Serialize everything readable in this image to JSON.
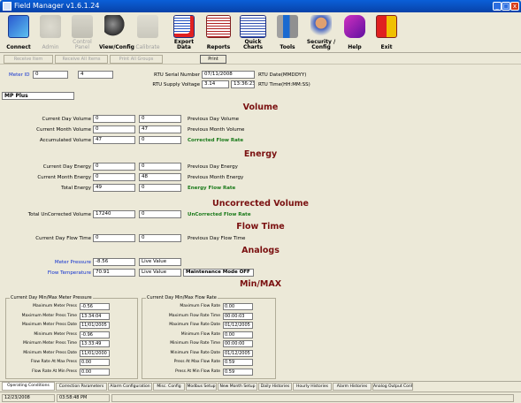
{
  "window": {
    "title": "Field Manager v1.6.1.24",
    "btn_min": "_",
    "btn_max": "□",
    "btn_close": "x"
  },
  "toolbar": [
    {
      "label": "Connect",
      "icon": "connect-icon",
      "enabled": true
    },
    {
      "label": "Admin",
      "icon": "admin-icon",
      "enabled": false
    },
    {
      "label": "Control Panel",
      "icon": "control-panel-icon",
      "enabled": false
    },
    {
      "label": "View/Config",
      "icon": "view-config-icon",
      "enabled": true
    },
    {
      "label": "Calibrate",
      "icon": "calibrate-icon",
      "enabled": false
    },
    {
      "label": "Export Data",
      "icon": "export-data-icon",
      "enabled": true
    },
    {
      "label": "Reports",
      "icon": "reports-icon",
      "enabled": true
    },
    {
      "label": "Quick Charts",
      "icon": "quick-charts-icon",
      "enabled": true
    },
    {
      "label": "Tools",
      "icon": "tools-icon",
      "enabled": true
    },
    {
      "label": "Security / Config",
      "icon": "security-config-icon",
      "enabled": true
    },
    {
      "label": "Help",
      "icon": "help-icon",
      "enabled": true
    },
    {
      "label": "Exit",
      "icon": "exit-icon",
      "enabled": true
    }
  ],
  "subbar": {
    "receive_item": "Receive Item",
    "receive_all": "Receive All Items",
    "print_all": "Print All Groups",
    "print": "Print"
  },
  "header": {
    "meter_id_label": "Meter ID",
    "meter_id": "0",
    "meter_id2": "4",
    "rtu_serial_label": "RTU Serial Number",
    "rtu_serial": "07/11/2008",
    "rtu_date_label": "RTU Date(MMDDYY)",
    "rtu_supply_label": "RTU Supply Voltage",
    "rtu_supply": "3.14",
    "rtu_time": "13:36:23",
    "rtu_time_label": "RTU Time(HH:MM:SS)",
    "meter_type": "MP Plus"
  },
  "volume": {
    "title": "Volume",
    "rows": [
      {
        "label": "Current Day Volume",
        "v1": "0",
        "v2": "0",
        "right": "Previous Day Volume",
        "right_style": "normal"
      },
      {
        "label": "Current Month Volume",
        "v1": "0",
        "v2": "47",
        "right": "Previous Month Volume",
        "right_style": "normal"
      },
      {
        "label": "Accumulated Volume",
        "v1": "47",
        "v2": "0",
        "right": "Corrected Flow Rate",
        "right_style": "green"
      }
    ]
  },
  "energy": {
    "title": "Energy",
    "rows": [
      {
        "label": "Current Day Energy",
        "v1": "0",
        "v2": "0",
        "right": "Previous Day Energy",
        "right_style": "normal"
      },
      {
        "label": "Current Month Energy",
        "v1": "0",
        "v2": "48",
        "right": "Previous Month Energy",
        "right_style": "normal"
      },
      {
        "label": "Total Energy",
        "v1": "49",
        "v2": "0",
        "right": "Energy Flow Rate",
        "right_style": "green"
      }
    ]
  },
  "uncorrected": {
    "title": "Uncorrected Volume",
    "label": "Total UnCorrected Volume",
    "v1": "17240",
    "v2": "0",
    "right": "UnCorrected Flow Rate"
  },
  "flowtime": {
    "title": "Flow Time",
    "label": "Current Day Flow Time",
    "v1": "0",
    "v2": "0",
    "right": "Previous Day Flow Time"
  },
  "analogs": {
    "title": "Analogs",
    "pressure_label": "Meter Pressure",
    "pressure": "-8.56",
    "pressure_mode": "Live Value",
    "temp_label": "Flow Temperature",
    "temp": "70.91",
    "temp_mode": "Live Value",
    "maintenance": "Maintenance Mode OFF"
  },
  "minmax": {
    "title": "Min/MAX",
    "left": {
      "title": "Current Day Min/Max Meter Pressure",
      "rows": [
        {
          "label": "Maximum Meter Press",
          "value": "-0.56"
        },
        {
          "label": "Maximum Meter Press Time",
          "value": "13:34:04"
        },
        {
          "label": "Maximum Meter Press Date",
          "value": "11/01/2005"
        },
        {
          "label": "Minimum Meter Press",
          "value": "-0.96"
        },
        {
          "label": "Minimum Meter Press Time",
          "value": "13:33:49"
        },
        {
          "label": "Minimum Meter Press Date",
          "value": "11/01/2000"
        },
        {
          "label": "Flow Rate At Max Press",
          "value": "0.00"
        },
        {
          "label": "Flow Rate At Min Press",
          "value": "0.00"
        }
      ]
    },
    "right": {
      "title": "Current Day Min/Max Flow Rate",
      "rows": [
        {
          "label": "Maximum Flow Rate",
          "value": "0.00"
        },
        {
          "label": "Maximum Flow Rate Time",
          "value": "00:00:03"
        },
        {
          "label": "Maximum Flow Rate Date",
          "value": "01/12/2005"
        },
        {
          "label": "Minimum Flow Rate",
          "value": "0.00"
        },
        {
          "label": "Minimum Flow Rate Time",
          "value": "00:00:00"
        },
        {
          "label": "Minimum Flow Rate Date",
          "value": "01/12/2005"
        },
        {
          "label": "Press At Max Flow Rate",
          "value": "0.59"
        },
        {
          "label": "Press At Min Flow Rate",
          "value": "0.59"
        }
      ]
    }
  },
  "tabs": [
    "Operating Conditions",
    "Correction Parameters",
    "Alarm Configuration",
    "Misc. Config",
    "Modbus Setup",
    "New Month Setup",
    "Daily Histories",
    "Hourly Histories",
    "Alarm Histories",
    "Analog Output Config"
  ],
  "status": {
    "date": "12/23/2008",
    "time": "03:58:48 PM"
  }
}
